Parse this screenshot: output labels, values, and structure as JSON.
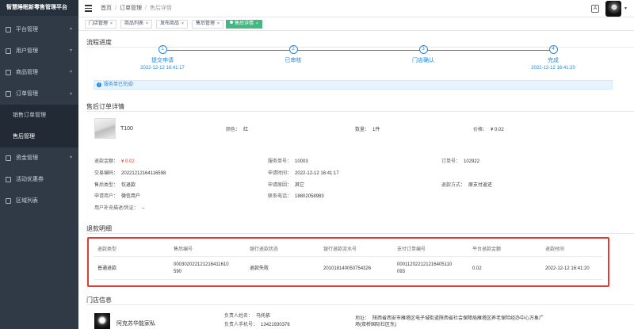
{
  "app": {
    "brand": "智慧睡眠新零售管理平台"
  },
  "sidebar": {
    "items": [
      {
        "label": "平台管理",
        "arrow": "▾"
      },
      {
        "label": "用户管理",
        "arrow": "▾"
      },
      {
        "label": "商品管理",
        "arrow": "▾"
      },
      {
        "label": "订单管理",
        "arrow": "▴"
      },
      {
        "label": "资金管理",
        "arrow": "▾"
      },
      {
        "label": "活动优惠券",
        "arrow": ""
      },
      {
        "label": "区域列表",
        "arrow": ""
      }
    ],
    "order_sub": [
      {
        "label": "销售订单管理"
      },
      {
        "label": "售后管理"
      }
    ]
  },
  "header": {
    "breadcrumb": [
      "首页",
      "订单管理",
      "售后详情"
    ],
    "lang_icon_label": "A"
  },
  "tags": [
    {
      "label": "门店管理"
    },
    {
      "label": "商品列表"
    },
    {
      "label": "发布商品"
    },
    {
      "label": "售后管理"
    },
    {
      "label": "售后详情"
    }
  ],
  "progress": {
    "title": "流程进度",
    "steps": [
      {
        "num": "1",
        "label": "提交申请",
        "time": "2022-12-12 16:41:17"
      },
      {
        "num": "2",
        "label": "已审核",
        "time": ""
      },
      {
        "num": "3",
        "label": "门店确认",
        "time": ""
      },
      {
        "num": "4",
        "label": "完成",
        "time": "2022-12-12 16:41:20"
      }
    ],
    "alert": "服务单已完成!"
  },
  "detail": {
    "title": "售后订单详情",
    "product": {
      "name": "T100",
      "color_label": "颜色：",
      "color": "红",
      "qty_label": "数量：",
      "qty": "1件",
      "price_label": "价格：",
      "price": "¥ 0.02"
    },
    "fields": {
      "refund_amount_label": "退款金额：",
      "refund_amount": "¥ 0.02",
      "service_no_label": "服务单号：",
      "service_no": "10003",
      "order_no_label": "订单号：",
      "order_no": "102922",
      "trade_no_label": "交易编码：",
      "trade_no": "20221212164116598",
      "apply_time_label": "申请时间：",
      "apply_time": "2022-12-12 16:41:17",
      "type_label": "售后类型：",
      "type": "仅退款",
      "reason_label": "申请原因：",
      "reason": "其它",
      "method_label": "退款方式：",
      "method": "原支付返还",
      "user_label": "申请用户：",
      "user": "微信用户",
      "phone_label": "联系电话：",
      "phone": "18802058983",
      "extra_label": "用户补充描述/凭证：",
      "extra": "--"
    }
  },
  "refund": {
    "title": "退款明细",
    "headers": [
      "退款类型",
      "售后编号",
      "银行退款状态",
      "银行退款流水号",
      "支付订单编号",
      "平台退款金额",
      "退款时间"
    ],
    "row": {
      "type": "普通退款",
      "aftersale_no": "000302022121216411610590",
      "bank_status": "退款失败",
      "bank_serial": "201018140050754326",
      "pay_order_no": "000112022121216405110093",
      "amount": "0.02",
      "time": "2022-12-12 16:41:20"
    }
  },
  "store": {
    "title": "门店信息",
    "name": "阿克苏华能家私",
    "owner_label": "负责人姓名：",
    "owner": "马托依",
    "owner_phone_label": "负责人手机号：",
    "owner_phone": "13421930376",
    "address_label": "地址：",
    "address": "陕西省西安市雁塔区电子城街道陕西省社会保障局雁塔区养老保险经办中心万象广场(双桥国际社区东)"
  }
}
